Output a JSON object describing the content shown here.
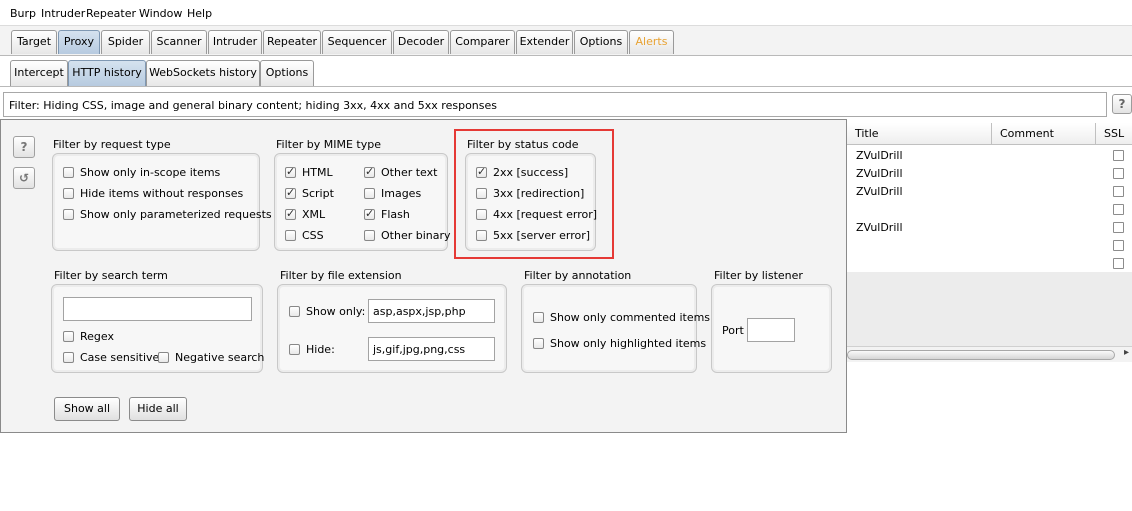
{
  "menu": [
    "Burp",
    "Intruder",
    "Repeater",
    "Window",
    "Help"
  ],
  "top_tabs": [
    {
      "label": "Target"
    },
    {
      "label": "Proxy"
    },
    {
      "label": "Spider"
    },
    {
      "label": "Scanner"
    },
    {
      "label": "Intruder"
    },
    {
      "label": "Repeater"
    },
    {
      "label": "Sequencer"
    },
    {
      "label": "Decoder"
    },
    {
      "label": "Comparer"
    },
    {
      "label": "Extender"
    },
    {
      "label": "Options"
    },
    {
      "label": "Alerts"
    }
  ],
  "selected_top_tab": "Proxy",
  "sub_tabs": [
    {
      "label": "Intercept"
    },
    {
      "label": "HTTP history"
    },
    {
      "label": "WebSockets history"
    },
    {
      "label": "Options"
    }
  ],
  "selected_sub_tab": "HTTP history",
  "filter_bar": {
    "text": "Filter:  Hiding CSS, image and general binary content;  hiding 3xx, 4xx and 5xx responses",
    "help": "?"
  },
  "table": {
    "columns": [
      "Title",
      "Comment",
      "SSL"
    ],
    "rows": [
      {
        "title": "ZVulDrill"
      },
      {
        "title": "ZVulDrill"
      },
      {
        "title": "ZVulDrill"
      },
      {
        "title": ""
      },
      {
        "title": "ZVulDrill"
      },
      {
        "title": ""
      },
      {
        "title": ""
      }
    ],
    "scroll_arrow": "▸"
  },
  "popup": {
    "help": "?",
    "reset": "↺",
    "request_type": {
      "title": "Filter by request type",
      "items": [
        {
          "label": "Show only in-scope items",
          "checked": false
        },
        {
          "label": "Hide items without responses",
          "checked": false
        },
        {
          "label": "Show only parameterized requests",
          "checked": false
        }
      ]
    },
    "mime_type": {
      "title": "Filter by MIME type",
      "items": [
        {
          "label": "HTML",
          "checked": true
        },
        {
          "label": "Other text",
          "checked": true
        },
        {
          "label": "Script",
          "checked": true
        },
        {
          "label": "Images",
          "checked": false
        },
        {
          "label": "XML",
          "checked": true
        },
        {
          "label": "Flash",
          "checked": true
        },
        {
          "label": "CSS",
          "checked": false
        },
        {
          "label": "Other binary",
          "checked": false
        }
      ]
    },
    "status_code": {
      "title": "Filter by status code",
      "items": [
        {
          "label": "2xx  [success]",
          "checked": true
        },
        {
          "label": "3xx  [redirection]",
          "checked": false
        },
        {
          "label": "4xx  [request error]",
          "checked": false
        },
        {
          "label": "5xx  [server error]",
          "checked": false
        }
      ]
    },
    "search_term": {
      "title": "Filter by search term",
      "value": "",
      "regex": "Regex",
      "case_sensitive": "Case sensitive",
      "negative": "Negative search"
    },
    "file_extension": {
      "title": "Filter by file extension",
      "show_only_label": "Show only:",
      "show_only_value": "asp,aspx,jsp,php",
      "hide_label": "Hide:",
      "hide_value": "js,gif,jpg,png,css"
    },
    "annotation": {
      "title": "Filter by annotation",
      "commented": "Show only commented items",
      "highlighted": "Show only highlighted items"
    },
    "listener": {
      "title": "Filter by listener",
      "port_label": "Port",
      "port_value": ""
    },
    "show_all": "Show all",
    "hide_all": "Hide all"
  },
  "colors": {
    "alert_tab": "#e8a232",
    "highlight_box": "#e53935",
    "selected_tab": "#b7cbe0"
  }
}
